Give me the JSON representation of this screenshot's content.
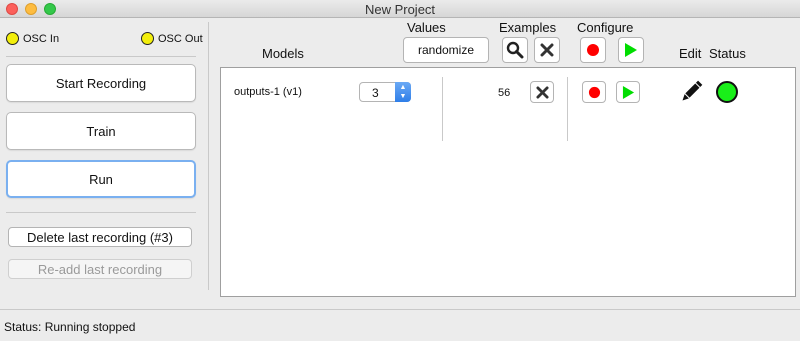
{
  "window": {
    "title": "New Project"
  },
  "osc": {
    "in_label": "OSC In",
    "out_label": "OSC Out",
    "indicator_color": "#f2ee0c"
  },
  "left_panel": {
    "start_recording": "Start Recording",
    "train": "Train",
    "run": "Run",
    "delete_last": "Delete last recording (#3)",
    "readd_last": "Re-add last recording"
  },
  "headers": {
    "models": "Models",
    "values": "Values",
    "examples": "Examples",
    "configure": "Configure",
    "edit": "Edit",
    "status": "Status"
  },
  "values": {
    "randomize_label": "randomize"
  },
  "model_row": {
    "name": "outputs-1 (v1)",
    "value": "3",
    "examples_count": "56",
    "status_color": "#19ef19"
  },
  "icons": {
    "search": "search-icon",
    "delete": "x-icon",
    "record": "record-icon",
    "play": "play-icon",
    "edit": "pencil-icon",
    "record_color": "#ff0000",
    "play_color": "#00dd00"
  },
  "statusbar": {
    "text": "Status: Running stopped"
  }
}
